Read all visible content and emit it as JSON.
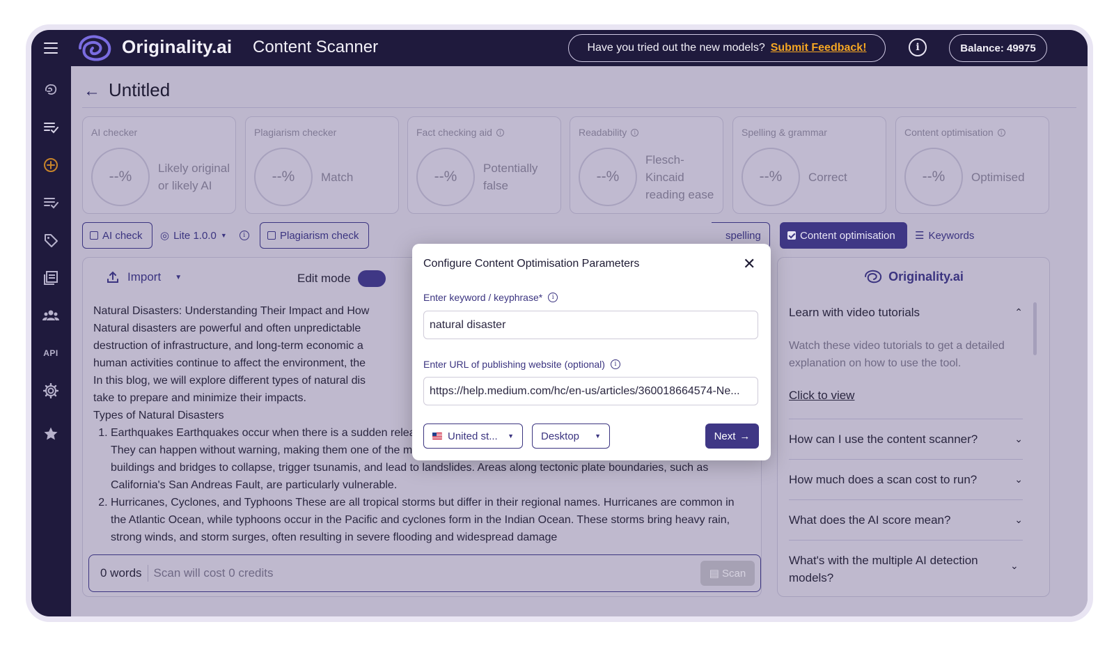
{
  "topbar": {
    "brand": "Originality.ai",
    "app_title": "Content Scanner",
    "feedback_prompt": "Have you tried out the new models?",
    "feedback_link": "Submit Feedback!",
    "balance": "Balance: 49975"
  },
  "sidebar": {
    "icons": [
      "brain-icon",
      "list-check-icon",
      "plus-circle-icon",
      "list-check-icon",
      "tag-icon",
      "library-icon",
      "team-icon",
      "api-icon",
      "gear-icon",
      "star-icon"
    ],
    "api_label": "API",
    "active_index": 2
  },
  "document": {
    "title": "Untitled"
  },
  "cards": [
    {
      "label": "AI checker",
      "value": "--%",
      "desc": "Likely original or likely AI",
      "info": false
    },
    {
      "label": "Plagiarism checker",
      "value": "--%",
      "desc": "Match",
      "info": false
    },
    {
      "label": "Fact checking aid",
      "value": "--%",
      "desc": "Potentially false",
      "info": true
    },
    {
      "label": "Readability",
      "value": "--%",
      "desc": "Flesch-Kincaid reading ease",
      "info": true
    },
    {
      "label": "Spelling & grammar",
      "value": "--%",
      "desc": "Correct",
      "info": false
    },
    {
      "label": "Content optimisation",
      "value": "--%",
      "desc": "Optimised",
      "info": true
    }
  ],
  "toolbar": {
    "ai_check": "AI check",
    "model": "Lite 1.0.0",
    "plagiarism_check": "Plagiarism check",
    "spelling": "spelling",
    "content_optimisation": "Content optimisation",
    "keywords": "Keywords"
  },
  "editor": {
    "import_label": "Import",
    "edit_mode_label": "Edit mode",
    "lines": [
      "Natural Disasters: Understanding Their Impact and How",
      "Natural disasters are powerful and often unpredictable",
      "destruction of infrastructure, and long-term economic a",
      "human activities continue to affect the environment, the",
      "In this blog, we will explore different types of natural dis",
      "take to prepare and minimize their impacts.",
      "Types of Natural Disasters"
    ],
    "list_items": [
      "Earthquakes Earthquakes occur when there is a sudden release of energy within the Earth's crust, causing the ground to shake. They can happen without warning, making them one of the most destructive natural disasters. Large earthquakes can cause buildings and bridges to collapse, trigger tsunamis, and lead to landslides. Areas along tectonic plate boundaries, such as California's San Andreas Fault, are particularly vulnerable.",
      "Hurricanes, Cyclones, and Typhoons These are all tropical storms but differ in their regional names. Hurricanes are common in the Atlantic Ocean, while typhoons occur in the Pacific and cyclones form in the Indian Ocean. These storms bring heavy rain, strong winds, and storm surges, often resulting in severe flooding and widespread damage"
    ],
    "word_count": "0 words",
    "scan_cost": "Scan will cost 0 credits",
    "scan_label": "Scan"
  },
  "help": {
    "brand": "Originality.ai",
    "expanded_title": "Learn with video tutorials",
    "expanded_body": "Watch these video tutorials to get a detailed explanation on how to use the tool.",
    "expanded_link": "Click to view",
    "faqs": [
      "How can I use the content scanner?",
      "How much does a scan cost to run?",
      "What does the AI score mean?",
      "What's with the multiple AI detection models?"
    ]
  },
  "modal": {
    "title": "Configure Content Optimisation Parameters",
    "keyword_label": "Enter keyword / keyphrase*",
    "keyword_value": "natural disaster",
    "url_label": "Enter URL of publishing website (optional)",
    "url_value": "https://help.medium.com/hc/en-us/articles/360018664574-Ne...",
    "country": "United st...",
    "device": "Desktop",
    "next_label": "Next"
  },
  "colors": {
    "navy": "#1f1a3d",
    "primary": "#3f3785",
    "accent": "#f5a623",
    "active_icon": "#c8842a"
  }
}
